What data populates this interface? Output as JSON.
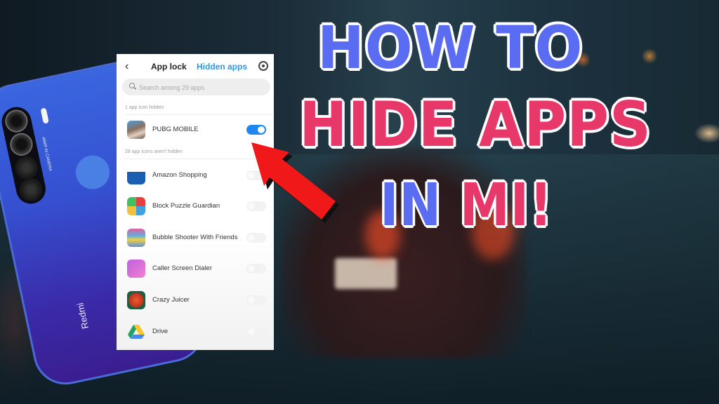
{
  "thumbnail": {
    "title_lines": [
      {
        "words": [
          {
            "text": "HOW",
            "color": "#5a6cf2"
          },
          {
            "text": "TO",
            "color": "#5a6cf2"
          }
        ]
      },
      {
        "words": [
          {
            "text": "HIDE",
            "color": "#e8386a"
          },
          {
            "text": "APPS",
            "color": "#e8386a"
          }
        ]
      },
      {
        "words": [
          {
            "text": "IN",
            "color": "#5a6cf2"
          },
          {
            "text": "MI!",
            "color": "#e8386a"
          }
        ]
      }
    ]
  },
  "phone": {
    "brand": "Redmi",
    "camera_label": "48MP AI CAMERA"
  },
  "app": {
    "header": {
      "back_icon": "chevron-left-icon",
      "tabs": [
        {
          "label": "App lock",
          "active": false
        },
        {
          "label": "Hidden apps",
          "active": true
        }
      ],
      "settings_icon": "gear-icon"
    },
    "search": {
      "placeholder": "Search among 29 apps",
      "value": ""
    },
    "hidden_section": {
      "label": "1 app icon hidden",
      "apps": [
        {
          "name": "PUBG MOBILE",
          "hidden": true
        }
      ]
    },
    "visible_section": {
      "label": "28 app icons aren't hidden",
      "apps": [
        {
          "name": "Amazon Shopping",
          "hidden": false
        },
        {
          "name": "Block Puzzle Guardian",
          "hidden": false
        },
        {
          "name": "Bubble Shooter With Friends",
          "hidden": false
        },
        {
          "name": "Caller Screen Dialer",
          "hidden": false
        },
        {
          "name": "Crazy Juicer",
          "hidden": false
        },
        {
          "name": "Drive",
          "hidden": false
        }
      ]
    },
    "accent_color": "#1e88f0"
  }
}
